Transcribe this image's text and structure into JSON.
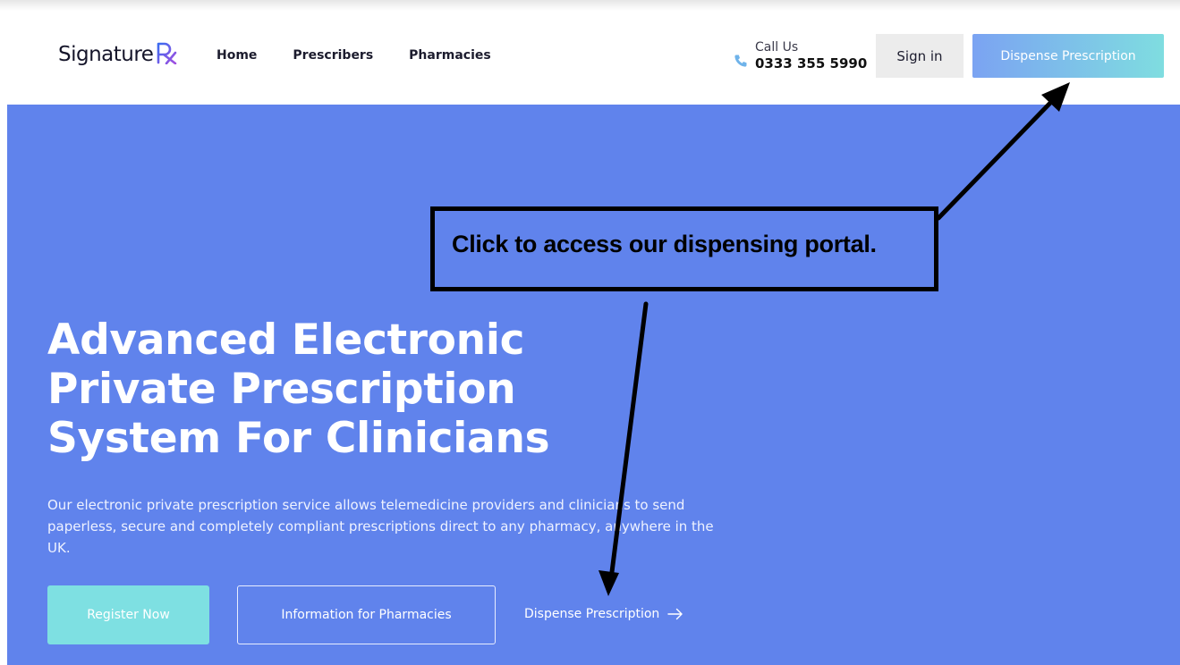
{
  "header": {
    "logo": {
      "text": "Signature",
      "mark": "Rx"
    },
    "nav": [
      {
        "label": "Home"
      },
      {
        "label": "Prescribers"
      },
      {
        "label": "Pharmacies"
      }
    ],
    "call": {
      "label": "Call Us",
      "number": "0333 355 5990",
      "icon": "phone-icon"
    },
    "signin_label": "Sign in",
    "dispense_label": "Dispense Prescription"
  },
  "hero": {
    "title_lines": [
      "Advanced Electronic",
      "Private Prescription",
      "System For Clinicians"
    ],
    "description": "Our electronic private prescription service allows telemedicine providers and clinicians to send paperless, secure and completely compliant prescriptions direct to any pharmacy, anywhere in the UK.",
    "register_label": "Register Now",
    "info_label": "Information for Pharmacies",
    "dispense_link_label": "Dispense Prescription",
    "dispense_link_icon": "arrow-right-icon"
  },
  "annotation": {
    "text": "Click to access our dispensing portal."
  },
  "colors": {
    "hero_bg": "#6083ec",
    "accent_teal": "#7ee0e2",
    "accent_blue": "#7ba3f2",
    "logo_purple": "#7a4fe0"
  }
}
